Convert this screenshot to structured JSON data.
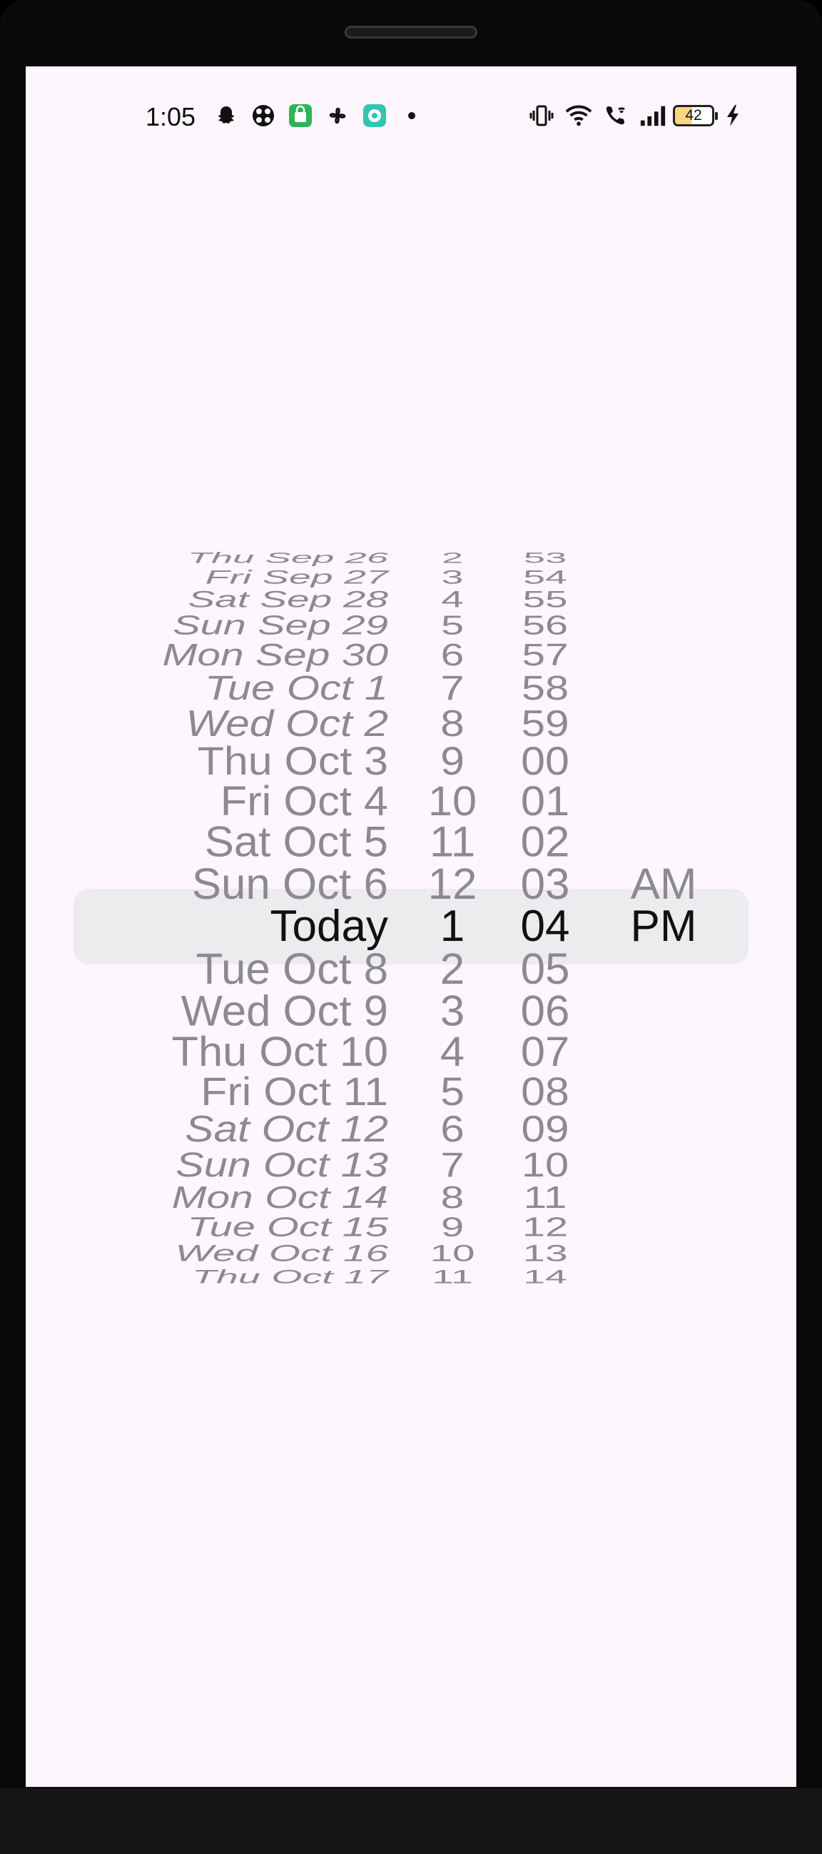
{
  "status_bar": {
    "time": "1:05",
    "left_icons": [
      "snapchat-icon",
      "game-controller-icon",
      "shopping-bag-icon",
      "pinwheel-icon",
      "chat-app-icon",
      "notification-dot-icon"
    ],
    "right_icons": [
      "vibrate-icon",
      "wifi-icon",
      "wifi-calling-icon",
      "signal-bars-icon"
    ],
    "battery_level": "42",
    "charging": true
  },
  "picker": {
    "selected_index": 12,
    "rows": [
      {
        "date": "Thu Sep 26",
        "hour": "2",
        "minute": "53",
        "ampm": ""
      },
      {
        "date": "Fri Sep 27",
        "hour": "3",
        "minute": "54",
        "ampm": ""
      },
      {
        "date": "Sat Sep 28",
        "hour": "4",
        "minute": "55",
        "ampm": ""
      },
      {
        "date": "Sun Sep 29",
        "hour": "5",
        "minute": "56",
        "ampm": ""
      },
      {
        "date": "Mon Sep 30",
        "hour": "6",
        "minute": "57",
        "ampm": ""
      },
      {
        "date": "Tue Oct 1",
        "hour": "7",
        "minute": "58",
        "ampm": ""
      },
      {
        "date": "Wed Oct 2",
        "hour": "8",
        "minute": "59",
        "ampm": ""
      },
      {
        "date": "Thu Oct 3",
        "hour": "9",
        "minute": "00",
        "ampm": ""
      },
      {
        "date": "Fri Oct 4",
        "hour": "10",
        "minute": "01",
        "ampm": ""
      },
      {
        "date": "Sat Oct 5",
        "hour": "11",
        "minute": "02",
        "ampm": ""
      },
      {
        "date": "Sun Oct 6",
        "hour": "12",
        "minute": "03",
        "ampm": "AM"
      },
      {
        "date": "Today",
        "hour": "1",
        "minute": "04",
        "ampm": "PM"
      },
      {
        "date": "Tue Oct 8",
        "hour": "2",
        "minute": "05",
        "ampm": ""
      },
      {
        "date": "Wed Oct 9",
        "hour": "3",
        "minute": "06",
        "ampm": ""
      },
      {
        "date": "Thu Oct 10",
        "hour": "4",
        "minute": "07",
        "ampm": ""
      },
      {
        "date": "Fri Oct 11",
        "hour": "5",
        "minute": "08",
        "ampm": ""
      },
      {
        "date": "Sat Oct 12",
        "hour": "6",
        "minute": "09",
        "ampm": ""
      },
      {
        "date": "Sun Oct 13",
        "hour": "7",
        "minute": "10",
        "ampm": ""
      },
      {
        "date": "Mon Oct 14",
        "hour": "8",
        "minute": "11",
        "ampm": ""
      },
      {
        "date": "Tue Oct 15",
        "hour": "9",
        "minute": "12",
        "ampm": ""
      },
      {
        "date": "Wed Oct 16",
        "hour": "10",
        "minute": "13",
        "ampm": ""
      },
      {
        "date": "Thu Oct 17",
        "hour": "11",
        "minute": "14",
        "ampm": ""
      }
    ]
  }
}
